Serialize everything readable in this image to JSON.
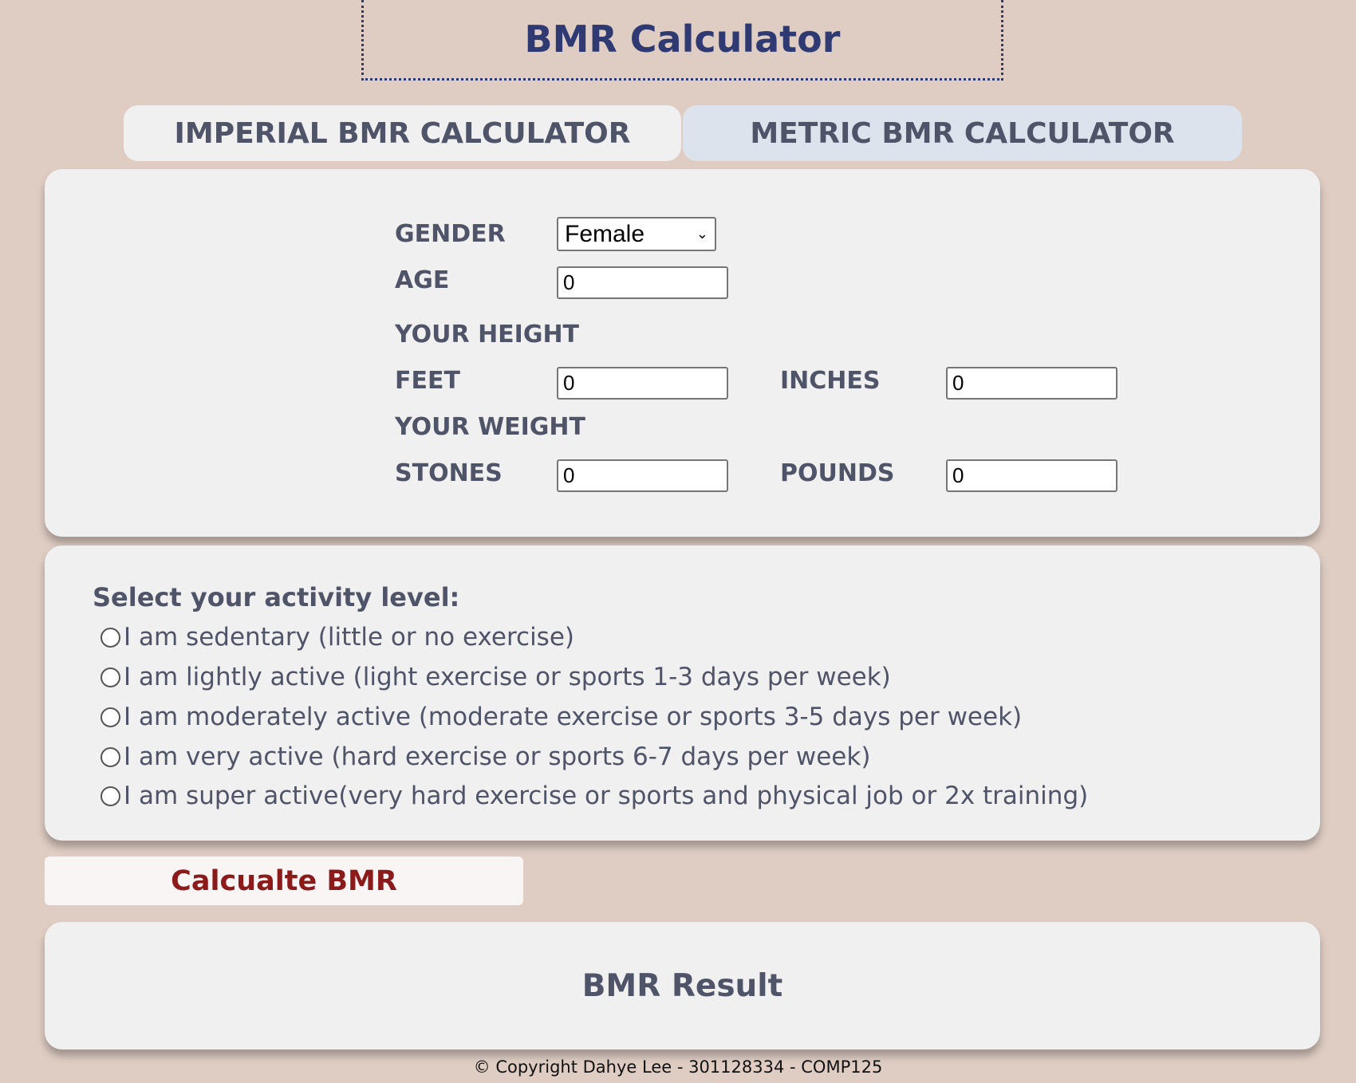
{
  "title": "BMR Calculator",
  "tabs": [
    {
      "label": "IMPERIAL BMR CALCULATOR"
    },
    {
      "label": "METRIC BMR CALCULATOR"
    }
  ],
  "form": {
    "gender_label": "GENDER",
    "gender_value": "Female",
    "age_label": "AGE",
    "age_value": "0",
    "height_heading": "YOUR HEIGHT",
    "feet_label": "FEET",
    "feet_value": "0",
    "inches_label": "INCHES",
    "inches_value": "0",
    "weight_heading": "YOUR WEIGHT",
    "stones_label": "STONES",
    "stones_value": "0",
    "pounds_label": "POUNDS",
    "pounds_value": "0"
  },
  "activity": {
    "heading": "Select your activity level:",
    "options": [
      "I am sedentary (little or no exercise)",
      "I am lightly active (light exercise or sports 1-3 days per week)",
      "I am moderately active (moderate exercise or sports 3-5 days per week)",
      "I am very active (hard exercise or sports 6-7 days per week)",
      "I am super active(very hard exercise or sports and physical job or 2x training)"
    ]
  },
  "button_label": "Calcualte BMR",
  "result_label": "BMR Result",
  "footer": "© Copyright Dahye Lee - 301128334 - COMP125",
  "colors": {
    "title": "#2f3a72",
    "text": "#4f5468",
    "button_text": "#8b1a1a",
    "background": "#dfcdc3"
  }
}
